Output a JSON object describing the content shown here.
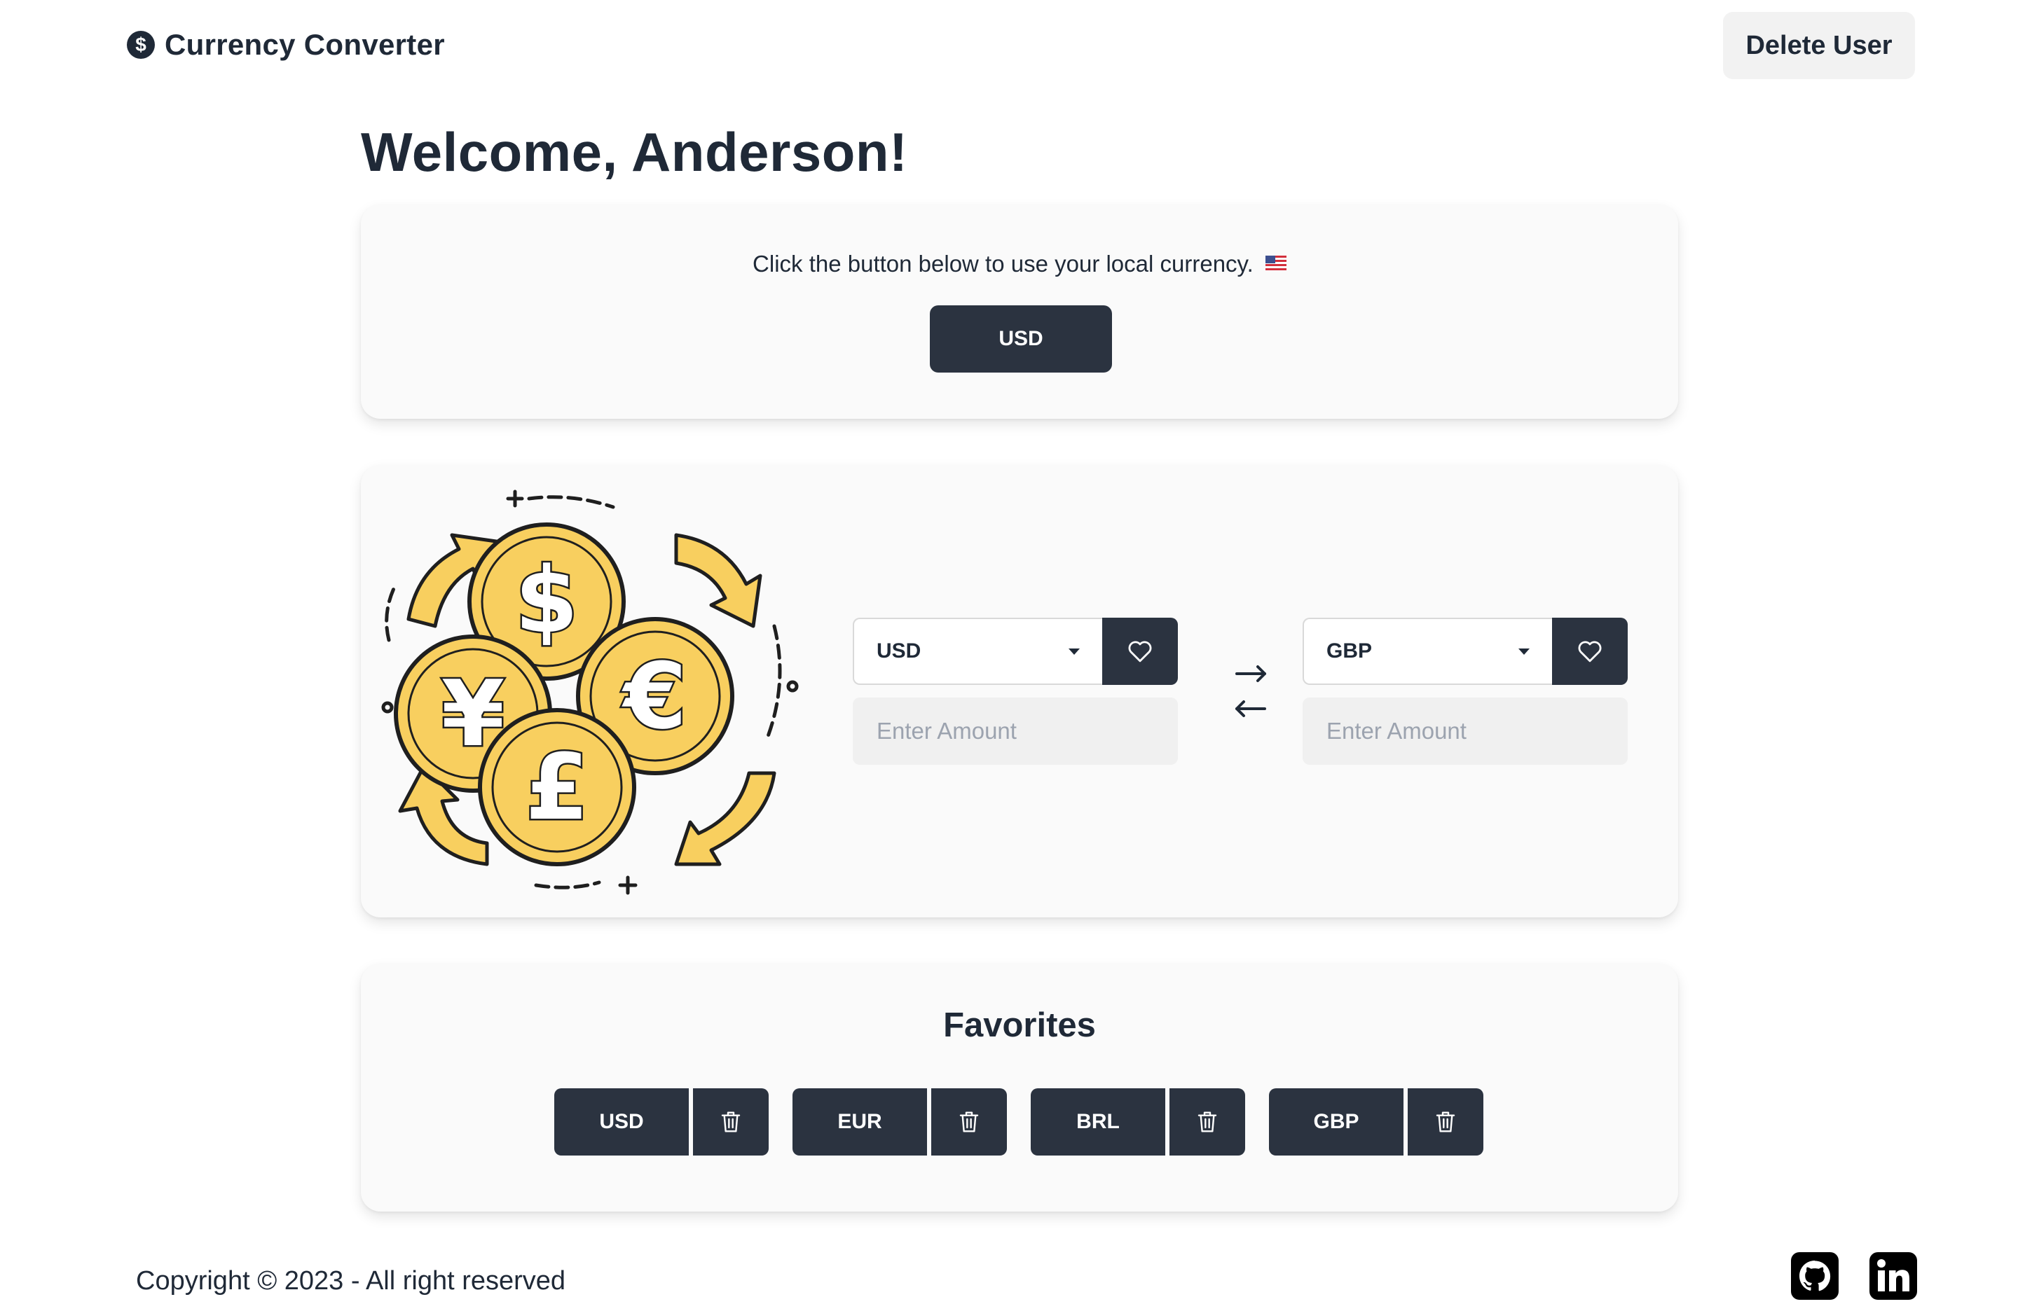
{
  "header": {
    "brand_icon": "dollar-sign",
    "brand_title": "Currency Converter",
    "delete_user_label": "Delete User"
  },
  "welcome": "Welcome, Anderson!",
  "local_currency": {
    "message": "Click the button below to use your local currency.",
    "flag_icon": "us-flag",
    "button_label": "USD"
  },
  "converter": {
    "from": {
      "currency": "USD",
      "amount_placeholder": "Enter Amount"
    },
    "to": {
      "currency": "GBP",
      "amount_placeholder": "Enter Amount"
    },
    "swap_icon": "left-right-arrows"
  },
  "favorites": {
    "title": "Favorites",
    "items": [
      {
        "code": "USD"
      },
      {
        "code": "EUR"
      },
      {
        "code": "BRL"
      },
      {
        "code": "GBP"
      }
    ]
  },
  "footer": {
    "copyright": "Copyright © 2023 - All right reserved",
    "social_icons": [
      "github-icon",
      "linkedin-icon"
    ]
  },
  "colors": {
    "primary_dark": "#2b3340",
    "card_bg": "#fafafa",
    "coin_gold": "#f8cf5f",
    "text": "#1f2937"
  }
}
